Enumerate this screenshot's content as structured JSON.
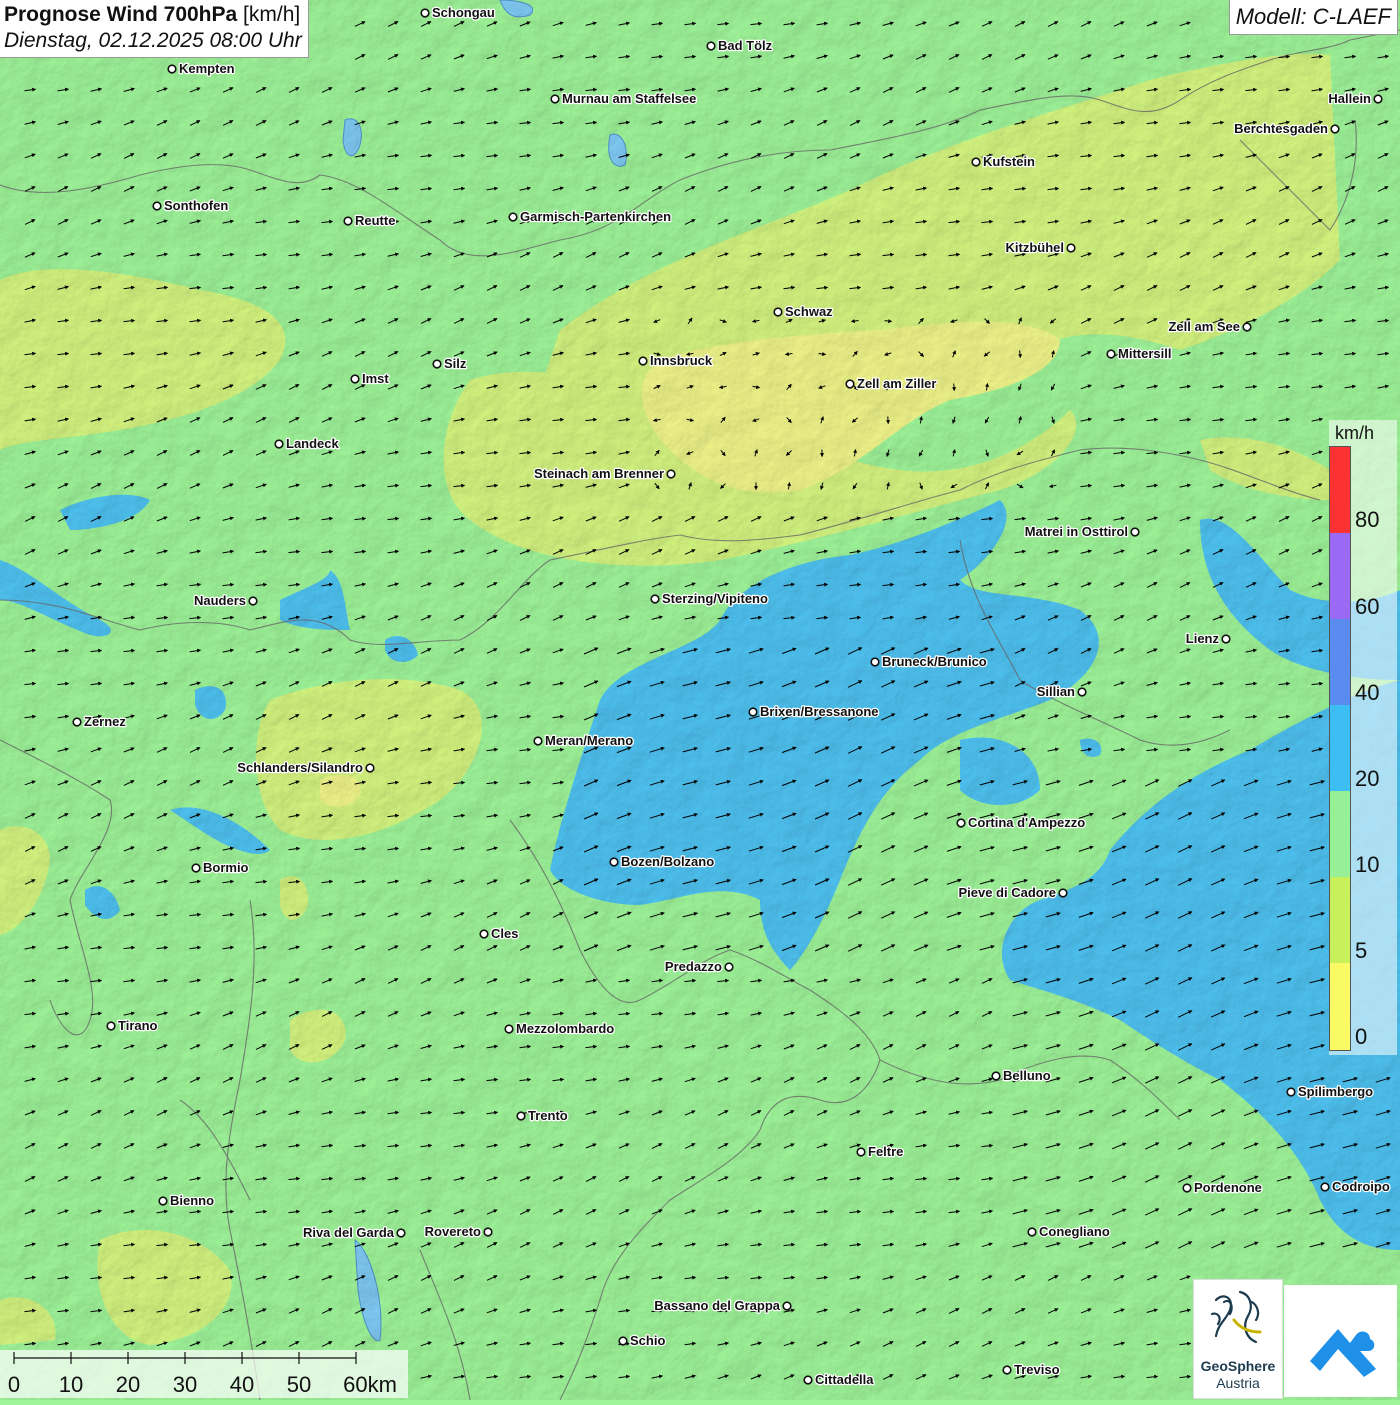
{
  "header": {
    "title": "Prognose Wind 700hPa",
    "unit": "[km/h]",
    "datetime": "Dienstag, 02.12.2025 08:00 Uhr",
    "model": "Modell: C-LAEF"
  },
  "legend": {
    "unit": "km/h",
    "ticks": [
      "80",
      "60",
      "40",
      "20",
      "10",
      "5",
      "0"
    ],
    "colors": {
      "c80": "#fa3232",
      "c60": "#9a6af5",
      "c40": "#5a8cf0",
      "c20": "#3cbef5",
      "c10": "#96f096",
      "c5": "#c8f05a",
      "c0": "#fafa64"
    }
  },
  "cities": [
    {
      "name": "Schongau"
    },
    {
      "name": "Bad Tölz"
    },
    {
      "name": "Kempten"
    },
    {
      "name": "Murnau am Staffelsee"
    },
    {
      "name": "Hallein"
    },
    {
      "name": "Berchtesgaden"
    },
    {
      "name": "Kufstein"
    },
    {
      "name": "Sonthofen"
    },
    {
      "name": "Reutte"
    },
    {
      "name": "Garmisch-Partenkirchen"
    },
    {
      "name": "Kitzbühel"
    },
    {
      "name": "Schwaz"
    },
    {
      "name": "Zell am See"
    },
    {
      "name": "Mittersill"
    },
    {
      "name": "Innsbruck"
    },
    {
      "name": "Silz"
    },
    {
      "name": "Imst"
    },
    {
      "name": "Zell am Ziller"
    },
    {
      "name": "Landeck"
    },
    {
      "name": "Steinach am Brenner"
    },
    {
      "name": "Matrei in Osttirol"
    },
    {
      "name": "Nauders"
    },
    {
      "name": "Sterzing/Vipiteno"
    },
    {
      "name": "Lienz"
    },
    {
      "name": "Bruneck/Brunico"
    },
    {
      "name": "Sillian"
    },
    {
      "name": "Zernez"
    },
    {
      "name": "Brixen/Bressanone"
    },
    {
      "name": "Meran/Merano"
    },
    {
      "name": "Schlanders/Silandro"
    },
    {
      "name": "Cortina d'Ampezzo"
    },
    {
      "name": "Bozen/Bolzano"
    },
    {
      "name": "Bormio"
    },
    {
      "name": "Pieve di Cadore"
    },
    {
      "name": "Cles"
    },
    {
      "name": "Predazzo"
    },
    {
      "name": "Tirano"
    },
    {
      "name": "Mezzolombardo"
    },
    {
      "name": "Belluno"
    },
    {
      "name": "Spilimbergo"
    },
    {
      "name": "Trento"
    },
    {
      "name": "Feltre"
    },
    {
      "name": "Pordenone"
    },
    {
      "name": "Codroipo"
    },
    {
      "name": "Bienno"
    },
    {
      "name": "Riva del Garda"
    },
    {
      "name": "Rovereto"
    },
    {
      "name": "Conegliano"
    },
    {
      "name": "Bassano del Grappa"
    },
    {
      "name": "Schio"
    },
    {
      "name": "Treviso"
    },
    {
      "name": "Cittadella"
    }
  ],
  "scale": {
    "ticks": [
      "0",
      "10",
      "20",
      "30",
      "40",
      "50",
      "60km"
    ]
  },
  "logo": {
    "name": "GeoSphere",
    "sub": "Austria"
  }
}
